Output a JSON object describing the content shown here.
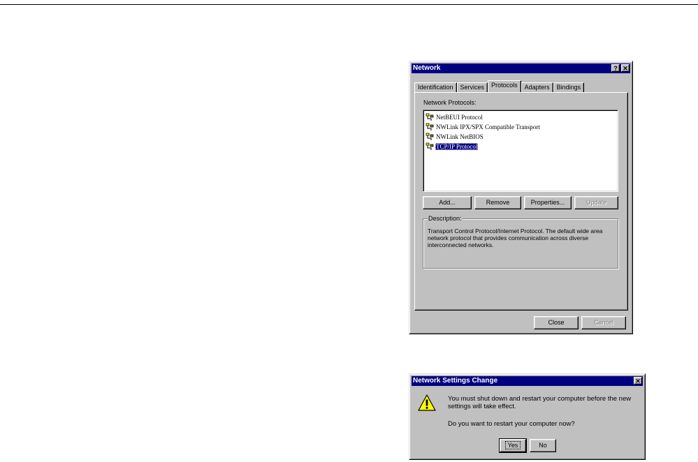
{
  "network_dialog": {
    "title": "Network",
    "title_buttons": {
      "help": "?",
      "close": "✕"
    },
    "tabs": [
      {
        "label": "Identification",
        "active": false
      },
      {
        "label": "Services",
        "active": false
      },
      {
        "label": "Protocols",
        "active": true
      },
      {
        "label": "Adapters",
        "active": false
      },
      {
        "label": "Bindings",
        "active": false
      }
    ],
    "protocols_label": "Network Protocols:",
    "protocols": [
      {
        "label": "NetBEUI Protocol",
        "icon": "network-cable-icon",
        "selected": false
      },
      {
        "label": "NWLink IPX/SPX Compatible Transport",
        "icon": "network-cable-icon",
        "selected": false
      },
      {
        "label": "NWLink NetBIOS",
        "icon": "network-cable-icon",
        "selected": false
      },
      {
        "label": "TCP/IP Protocol",
        "icon": "network-cable-icon",
        "selected": true
      }
    ],
    "buttons": {
      "add": "Add...",
      "remove": "Remove",
      "properties": "Properties...",
      "update": "Update"
    },
    "description_label": "Description:",
    "description_text": "Transport Control Protocol/Internet Protocol. The default wide area network protocol that provides communication across diverse interconnected networks.",
    "footer_buttons": {
      "close": "Close",
      "cancel": "Cancel"
    }
  },
  "settings_dialog": {
    "title": "Network Settings Change",
    "title_close": "✕",
    "icon": "warning-icon",
    "message": "You must shut down and restart your computer before the new settings will take effect.",
    "question": "Do you want to restart your computer now?",
    "buttons": {
      "yes": "Yes",
      "no": "No"
    }
  },
  "colors": {
    "titlebar": "#000080",
    "face": "#c0c0c0",
    "selection": "#000080",
    "warning": "#ffff00"
  }
}
